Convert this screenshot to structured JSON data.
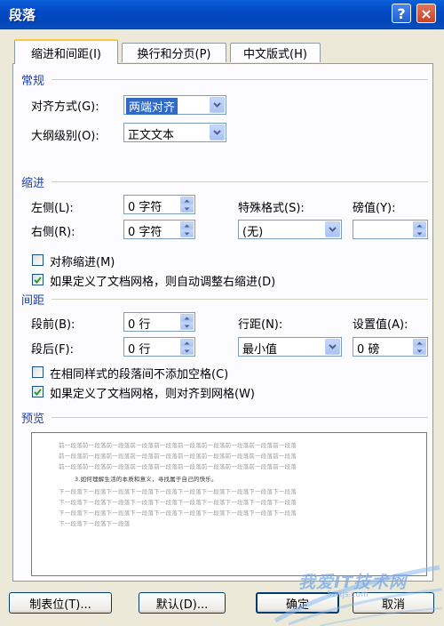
{
  "window": {
    "title": "段落",
    "help_label": "?",
    "close_label": "×"
  },
  "tabs": [
    {
      "label": "缩进和间距(I)",
      "active": true
    },
    {
      "label": "换行和分页(P)",
      "active": false
    },
    {
      "label": "中文版式(H)",
      "active": false
    }
  ],
  "general": {
    "title": "常规",
    "alignment_label": "对齐方式(G):",
    "alignment_value": "两端对齐",
    "outline_label": "大纲级别(O):",
    "outline_value": "正文文本"
  },
  "indent": {
    "title": "缩进",
    "left_label": "左侧(L):",
    "left_value": "0 字符",
    "right_label": "右侧(R):",
    "right_value": "0 字符",
    "special_label": "特殊格式(S):",
    "special_value": "(无)",
    "by_label": "磅值(Y):",
    "by_value": "",
    "mirror_label": "对称缩进(M)",
    "mirror_checked": false,
    "auto_adjust_label": "如果定义了文档网格，则自动调整右缩进(D)",
    "auto_adjust_checked": true
  },
  "spacing": {
    "title": "间距",
    "before_label": "段前(B):",
    "before_value": "0 行",
    "after_label": "段后(F):",
    "after_value": "0 行",
    "line_label": "行距(N):",
    "line_value": "最小值",
    "at_label": "设置值(A):",
    "at_value": "0 磅",
    "no_space_label": "在相同样式的段落间不添加空格(C)",
    "no_space_checked": false,
    "snap_grid_label": "如果定义了文档网格，则对齐到网格(W)",
    "snap_grid_checked": true
  },
  "preview": {
    "title": "预览",
    "prev_line": "前一段落前一段落前一段落前一段落前一段落前一段落前一段落前一段落前一段落前一段落",
    "sample_line": "3.如何理解生活的本质和意义，寻找属于自己的快乐。",
    "next_line": "下一段落下一段落下一段落下一段落下一段落下一段落下一段落下一段落下一段落下一段落",
    "next_short": "下一段落下一段落下一段落"
  },
  "buttons": {
    "tabs_label": "制表位(T)...",
    "default_label": "默认(D)...",
    "ok_label": "确定",
    "cancel_label": "取消"
  },
  "watermark": {
    "text": "我爱IT技术网",
    "sub": "52itjs.com"
  },
  "icons": {
    "dropdown": "chevron-down-icon",
    "spin": "spin-arrows-icon",
    "check": "check-icon"
  }
}
